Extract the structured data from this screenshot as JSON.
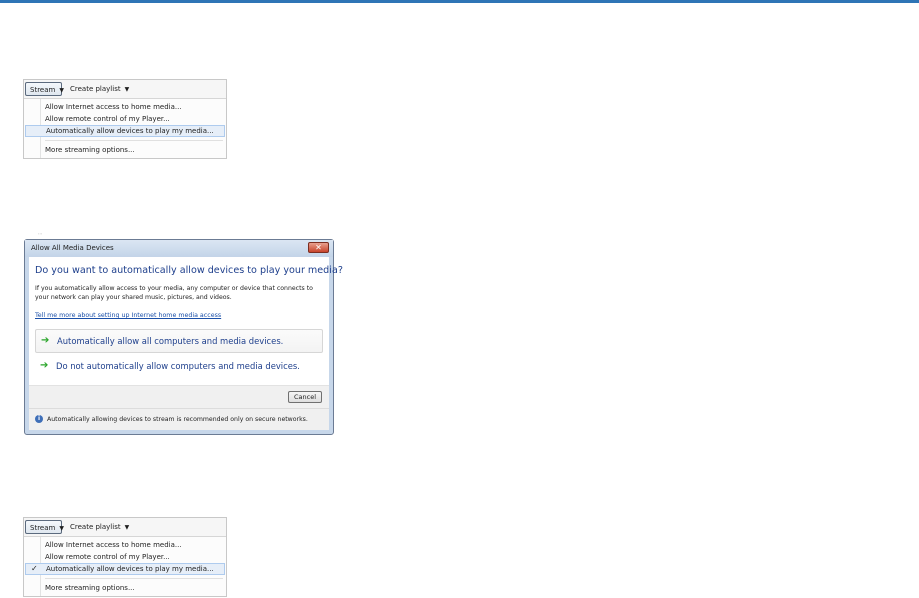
{
  "menus": [
    {
      "stream_label": "Stream",
      "create_playlist_label": "Create playlist",
      "items": [
        "Allow Internet access to home media...",
        "Allow remote control of my Player...",
        "Automatically allow devices to play my media...",
        "More streaming options..."
      ],
      "highlighted_index": 2,
      "checked_index": null
    },
    {
      "stream_label": "Stream",
      "create_playlist_label": "Create playlist",
      "items": [
        "Allow Internet access to home media...",
        "Allow remote control of my Player...",
        "Automatically allow devices to play my media...",
        "More streaming options..."
      ],
      "highlighted_index": 2,
      "checked_index": 2,
      "check_glyph": "✓"
    }
  ],
  "dialog": {
    "title": "Allow All Media Devices",
    "close_glyph": "✕",
    "heading": "Do you want to automatically allow devices to play your media?",
    "description": "If you automatically allow access to your media, any computer or device that connects to your network can play your shared music, pictures, and videos.",
    "link": "Tell me more about setting up Internet home media access",
    "option_allow": "Automatically allow all computers and media devices.",
    "option_deny": "Do not automatically allow computers and media devices.",
    "arrow_glyph": "➔",
    "cancel_label": "Cancel",
    "info_glyph": "i",
    "footer": "Automatically allowing devices to stream is recommended only on secure networks."
  },
  "icons": {
    "dropdown": "chevron-down-icon",
    "close": "close-icon",
    "arrow": "green-arrow-icon",
    "info": "info-icon",
    "check": "checkmark-icon"
  },
  "colors": {
    "accent_bar": "#2e75b6",
    "heading": "#1e3f8c",
    "link": "#1a4fa8",
    "arrow": "#2aa52a",
    "close": "#c8442b"
  }
}
